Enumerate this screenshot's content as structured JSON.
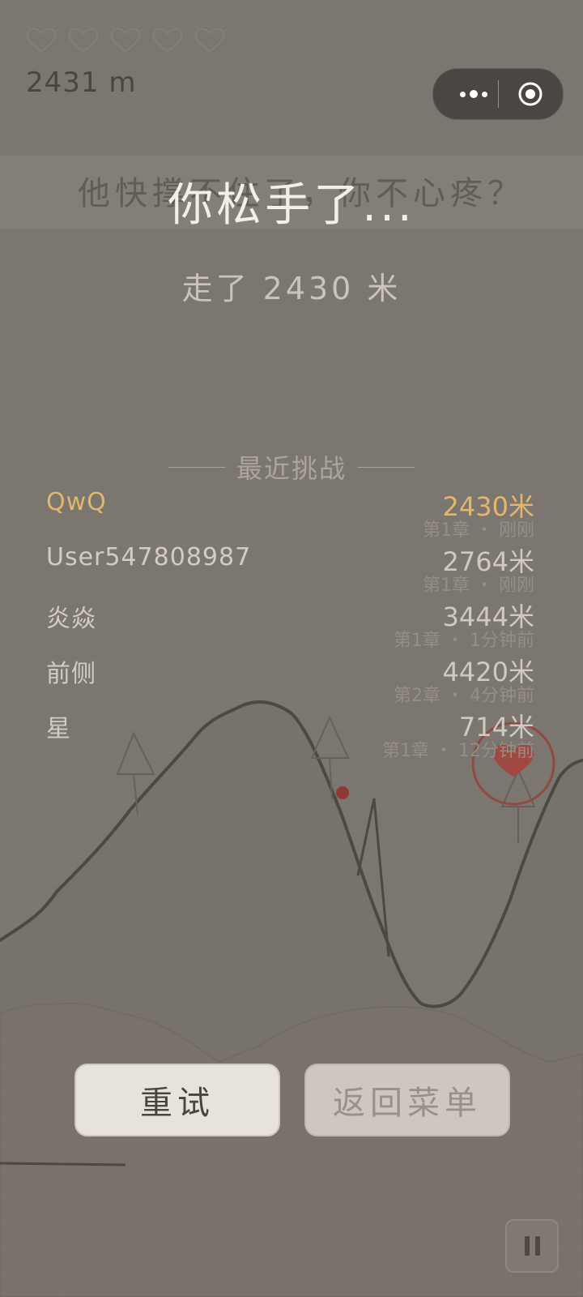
{
  "hud": {
    "lives_total": 5,
    "distance": "2431 m"
  },
  "banner": {
    "ghost_text": "他快撑不住了，你不心疼？",
    "title": "你松手了...",
    "subtitle": "走了 2430 米"
  },
  "leaderboard": {
    "heading": "最近挑战",
    "rows": [
      {
        "name": "QwQ",
        "distance": "2430米",
        "meta": "第1章 ・ 刚刚",
        "is_me": true
      },
      {
        "name": "User547808987",
        "distance": "2764米",
        "meta": "第1章 ・ 刚刚",
        "is_me": false
      },
      {
        "name": "炎焱",
        "distance": "3444米",
        "meta": "第1章 ・ 1分钟前",
        "is_me": false
      },
      {
        "name": "前侧",
        "distance": "4420米",
        "meta": "第2章 ・ 4分钟前",
        "is_me": false
      },
      {
        "name": "星",
        "distance": "714米",
        "meta": "第1章 ・ 12分钟前",
        "is_me": false
      }
    ]
  },
  "buttons": {
    "retry": "重试",
    "menu": "返回菜单"
  },
  "icons": {
    "heart": "heart-icon",
    "more": "more-dots-icon",
    "close": "target-close-icon",
    "pause": "pause-icon"
  },
  "colors": {
    "background": "#7b7670",
    "highlight": "#e3b66e",
    "title": "#f2efe9",
    "heart_pickup": "#b5443c"
  }
}
